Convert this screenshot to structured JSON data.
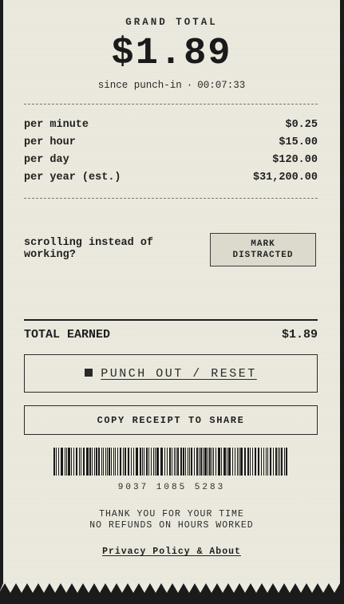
{
  "header": {
    "label": "GRAND TOTAL",
    "amount": "$1.89",
    "since_label": "since punch-in",
    "separator": "·",
    "elapsed": "00:07:33"
  },
  "rates": [
    {
      "label": "per minute",
      "value": "$0.25"
    },
    {
      "label": "per hour",
      "value": "$15.00"
    },
    {
      "label": "per day",
      "value": "$120.00"
    },
    {
      "label": "per year (est.)",
      "value": "$31,200.00"
    }
  ],
  "distraction": {
    "prompt": "scrolling instead of working?",
    "button_line1": "MARK",
    "button_line2": "DISTRACTED"
  },
  "total": {
    "label": "TOTAL EARNED",
    "value": "$1.89"
  },
  "actions": {
    "punch_out_label": "PUNCH OUT / RESET",
    "punch_out_icon": "stop-icon",
    "copy_label": "COPY RECEIPT TO SHARE"
  },
  "barcode": {
    "number": "9037 1085 5283"
  },
  "footer": {
    "thanks_line1": "THANK YOU FOR YOUR TIME",
    "thanks_line2": "NO REFUNDS ON HOURS WORKED",
    "privacy_link": "Privacy Policy & About"
  },
  "colors": {
    "paper": "#eceadf",
    "ink": "#1f1f1f",
    "backdrop": "#1b1b1b",
    "button_fill": "#dcd9cd"
  }
}
